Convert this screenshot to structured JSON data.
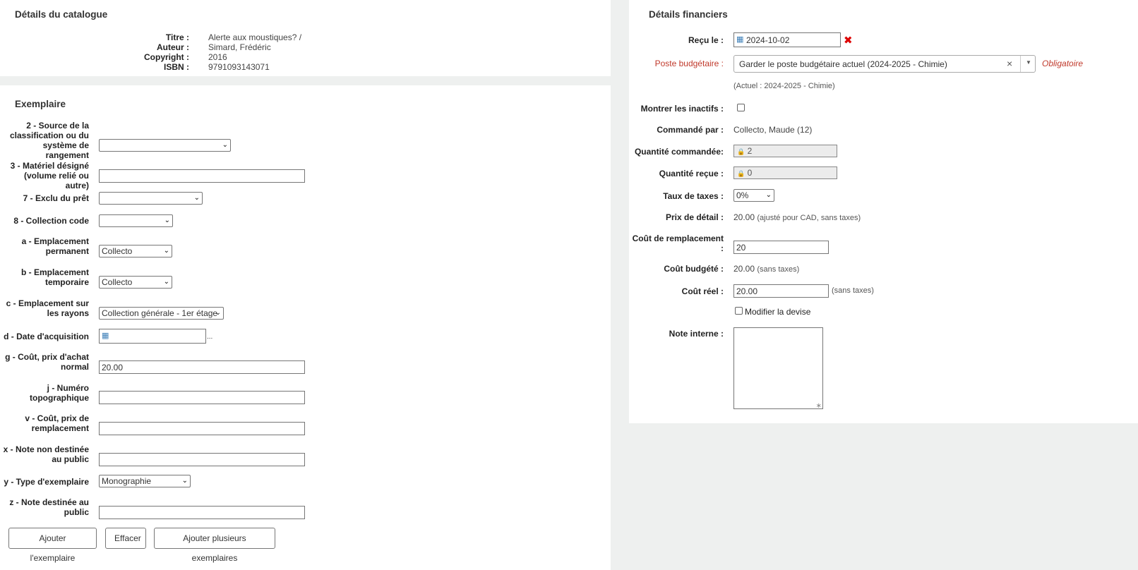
{
  "catalog": {
    "heading": "Détails du catalogue",
    "fields": [
      {
        "label": "Titre :",
        "value": "Alerte aux moustiques? /"
      },
      {
        "label": "Auteur :",
        "value": "Simard, Frédéric"
      },
      {
        "label": "Copyright :",
        "value": "2016"
      },
      {
        "label": "ISBN :",
        "value": "9791093143071"
      }
    ]
  },
  "item": {
    "heading": "Exemplaire",
    "source_label_1": "2 - Source de la",
    "source_label_2": "classification ou du",
    "source_label_3": "système de rangement",
    "material_label_1": "3 - Matériel désigné",
    "material_label_2": "(volume relié ou autre)",
    "notforloan_label": "7 - Exclu du prêt",
    "ccode_label": "8 - Collection code",
    "homebranch_label_1": "a - Emplacement",
    "homebranch_label_2": "permanent",
    "homebranch_value": "Collecto",
    "holdingbranch_label_1": "b - Emplacement",
    "holdingbranch_label_2": "temporaire",
    "holdingbranch_value": "Collecto",
    "location_label_1": "c - Emplacement sur",
    "location_label_2": "les rayons",
    "location_value": "Collection générale - 1er étage",
    "acqdate_label": "d - Date d'acquisition",
    "acqdate_suffix": "...",
    "price_label_1": "g - Coût, prix d'achat",
    "price_label_2": "normal",
    "price_value": "20.00",
    "callnumber_label_1": "j - Numéro",
    "callnumber_label_2": "topographique",
    "replprice_label_1": "v - Coût, prix de",
    "replprice_label_2": "remplacement",
    "nonpublic_label_1": "x - Note non destinée",
    "nonpublic_label_2": "au public",
    "itype_label": "y - Type d'exemplaire",
    "itype_value": "Monographie",
    "public_label_1": "z - Note destinée au",
    "public_label_2": "public",
    "buttons": {
      "add": "Ajouter l'exemplaire",
      "clear": "Effacer",
      "add_multiple": "Ajouter plusieurs exemplaires"
    }
  },
  "financial": {
    "heading": "Détails financiers",
    "received_label": "Reçu le :",
    "received_value": "2024-10-02",
    "fund_label": "Poste budgétaire :",
    "fund_value": "Garder le poste budgétaire actuel (2024-2025 - Chimie)",
    "fund_clear": "×",
    "fund_required": "Obligatoire",
    "fund_current": "(Actuel : 2024-2025 - Chimie)",
    "show_inactive_label": "Montrer les inactifs :",
    "ordered_by_label": "Commandé par :",
    "ordered_by_value": "Collecto, Maude (12)",
    "qty_ordered_label": "Quantité commandée:",
    "qty_ordered_value": "2",
    "qty_received_label": "Quantité reçue :",
    "qty_received_value": "0",
    "tax_label": "Taux de taxes :",
    "tax_value": "0%",
    "retail_label": "Prix de détail :",
    "retail_value": "20.00",
    "retail_note": "(ajusté pour CAD, sans taxes)",
    "repl_label_1": "Coût de remplacement",
    "repl_label_2": ":",
    "repl_value": "20",
    "budgeted_label": "Coût budgété :",
    "budgeted_value": "20.00",
    "budgeted_note": "(sans taxes)",
    "actual_label": "Coût réel :",
    "actual_value": "20.00",
    "actual_note": "(sans taxes)",
    "change_currency_label": "Modifier la devise",
    "internal_note_label": "Note interne :"
  },
  "colors": {
    "required": "#c0392b",
    "panel": "#ffffff",
    "background": "#eef0ef"
  }
}
